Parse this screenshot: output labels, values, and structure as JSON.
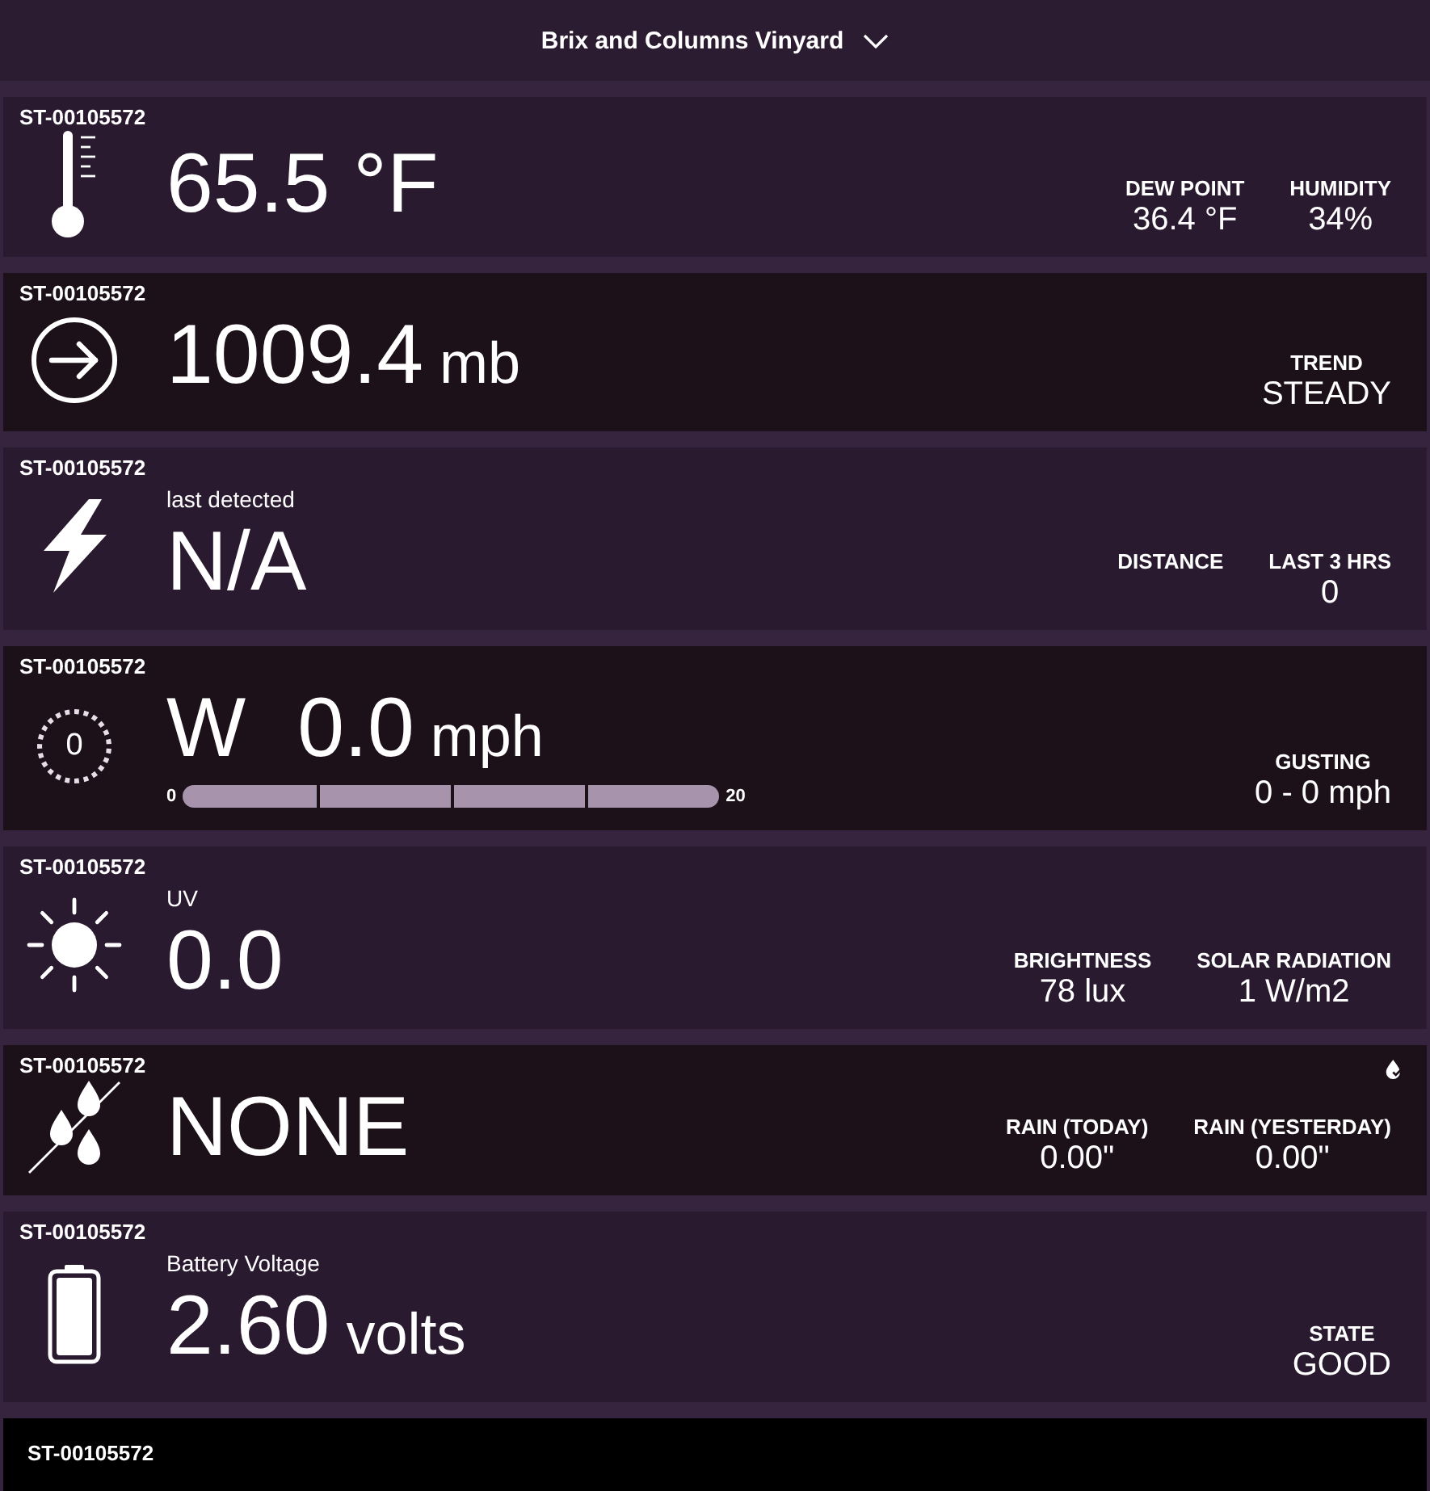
{
  "header": {
    "title": "Brix and Columns Vinyard"
  },
  "cards": [
    {
      "kind": "temperature",
      "station": "ST-00105572",
      "value": "65.5 °F",
      "stats": [
        {
          "label": "DEW POINT",
          "value": "36.4 °F"
        },
        {
          "label": "HUMIDITY",
          "value": "34%"
        }
      ]
    },
    {
      "kind": "pressure",
      "station": "ST-00105572",
      "value": "1009.4",
      "unit": "mb",
      "stats": [
        {
          "label": "TREND",
          "value": "STEADY"
        }
      ]
    },
    {
      "kind": "lightning",
      "station": "ST-00105572",
      "caption": "last detected",
      "value": "N/A",
      "stats": [
        {
          "label": "DISTANCE"
        },
        {
          "label": "LAST 3 HRS",
          "value": "0"
        }
      ]
    },
    {
      "kind": "wind",
      "station": "ST-00105572",
      "dial": "0",
      "direction": "W",
      "value": "0.0",
      "unit": "mph",
      "gauge": {
        "min": "0",
        "max": "20"
      },
      "stats": [
        {
          "label": "GUSTING",
          "value": "0 - 0 mph"
        }
      ]
    },
    {
      "kind": "uv",
      "station": "ST-00105572",
      "caption": "UV",
      "value": "0.0",
      "stats": [
        {
          "label": "BRIGHTNESS",
          "value": "78 lux"
        },
        {
          "label": "SOLAR RADIATION",
          "value": "1 W/m2"
        }
      ]
    },
    {
      "kind": "rain",
      "station": "ST-00105572",
      "value": "NONE",
      "stats": [
        {
          "label": "RAIN (TODAY)",
          "value": "0.00\""
        },
        {
          "label": "RAIN (YESTERDAY)",
          "value": "0.00\""
        }
      ]
    },
    {
      "kind": "battery",
      "station": "ST-00105572",
      "caption": "Battery Voltage",
      "value": "2.60",
      "unit": "volts",
      "stats": [
        {
          "label": "STATE",
          "value": "GOOD"
        }
      ]
    },
    {
      "kind": "station",
      "station": "ST-00105572"
    }
  ]
}
